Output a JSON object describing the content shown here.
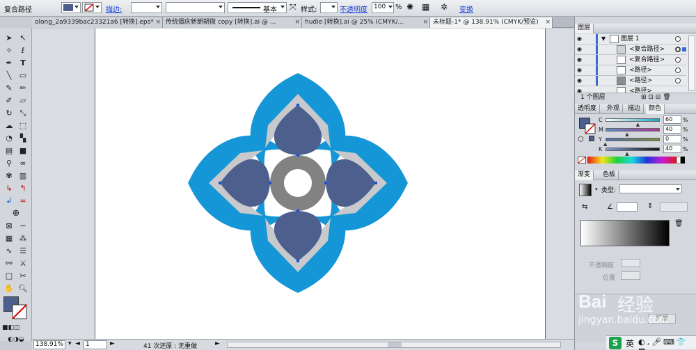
{
  "control_bar": {
    "object_type": "复合路径",
    "stroke_label": "描边:",
    "stroke_profile": "基本",
    "style_label": "样式:",
    "opacity_label": "不透明度",
    "opacity_value": "100",
    "opacity_unit": "%",
    "transform_label": "变换",
    "fill_color": "#4d5f8d"
  },
  "tabs": [
    {
      "label": "olong_2a9339bac23321a6 [转换].eps*",
      "close": "×"
    },
    {
      "label": "传统烟庆新朗朝微 copy [转换].ai @ ...",
      "close": "×"
    },
    {
      "label": "hudie [转换].ai @ 25% (CMYK/...",
      "close": "×"
    },
    {
      "label": "未标题-1* @ 138.91% (CMYK/预览)",
      "close": "×"
    }
  ],
  "status_bar": {
    "zoom": "138.91%",
    "artboard": "1",
    "history": "41 次还原 : 无重做"
  },
  "layers_panel": {
    "title": "图层",
    "rows": [
      {
        "name": "图层 1",
        "level": 0
      },
      {
        "name": "<复合路径>",
        "level": 1
      },
      {
        "name": "<复合路径>",
        "level": 1
      },
      {
        "name": "<路径>",
        "level": 1
      },
      {
        "name": "<路径>",
        "level": 1
      },
      {
        "name": "<路径>",
        "level": 1
      }
    ],
    "footer": "1 个图层"
  },
  "color_panel": {
    "tabs": [
      "透明度",
      "外观",
      "描边",
      "颜色"
    ],
    "channels": [
      {
        "label": "C",
        "value": "60",
        "unit": "%",
        "fraction": 0.6,
        "color": "#19a6c8"
      },
      {
        "label": "M",
        "value": "40",
        "unit": "%",
        "fraction": 0.4,
        "color": "#b0308e"
      },
      {
        "label": "Y",
        "value": "0",
        "unit": "%",
        "fraction": 0.0,
        "color": "#c8b43a"
      },
      {
        "label": "K",
        "value": "40",
        "unit": "%",
        "fraction": 0.4,
        "color": "#333333"
      }
    ]
  },
  "gradient_panel": {
    "tabs": [
      "渐变",
      "色板"
    ],
    "type_label": "类型:",
    "opacity_label": "不透明度",
    "location_label": "位置",
    "expand_label": "扩展"
  },
  "watermark": {
    "brand": "Bai",
    "text": "经验",
    "url": "jingyan.baidu.com"
  },
  "taskbar": {
    "ime": "英"
  },
  "artwork": {
    "outer_petal_color": "#1596d6",
    "middle_petal_color": "#c8c9cc",
    "inner_petal_color": "#4d5f8d",
    "center_ring_color": "#828282"
  }
}
